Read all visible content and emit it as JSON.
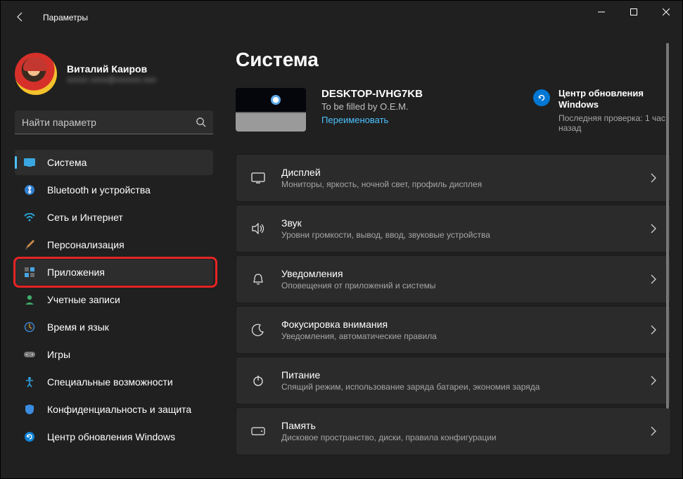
{
  "window": {
    "title": "Параметры"
  },
  "profile": {
    "name": "Виталий Каиров",
    "email": "xxxxx xxxx@xxxxxx.xxx"
  },
  "search": {
    "placeholder": "Найти параметр"
  },
  "sidebar": {
    "items": [
      {
        "label": "Система"
      },
      {
        "label": "Bluetooth и устройства"
      },
      {
        "label": "Сеть и Интернет"
      },
      {
        "label": "Персонализация"
      },
      {
        "label": "Приложения"
      },
      {
        "label": "Учетные записи"
      },
      {
        "label": "Время и язык"
      },
      {
        "label": "Игры"
      },
      {
        "label": "Специальные возможности"
      },
      {
        "label": "Конфиденциальность и защита"
      },
      {
        "label": "Центр обновления Windows"
      }
    ]
  },
  "main": {
    "heading": "Система",
    "device": {
      "name": "DESKTOP-IVHG7KB",
      "sub": "To be filled by O.E.M.",
      "rename": "Переименовать"
    },
    "update": {
      "title": "Центр обновления Windows",
      "sub": "Последняя проверка: 1 час назад"
    },
    "cards": [
      {
        "title": "Дисплей",
        "sub": "Мониторы, яркость, ночной свет, профиль дисплея"
      },
      {
        "title": "Звук",
        "sub": "Уровни громкости, вывод, ввод, звуковые устройства"
      },
      {
        "title": "Уведомления",
        "sub": "Оповещения от приложений и системы"
      },
      {
        "title": "Фокусировка внимания",
        "sub": "Уведомления, автоматические правила"
      },
      {
        "title": "Питание",
        "sub": "Спящий режим, использование заряда батареи, экономия заряда"
      },
      {
        "title": "Память",
        "sub": "Дисковое пространство, диски, правила конфигурации"
      }
    ]
  }
}
